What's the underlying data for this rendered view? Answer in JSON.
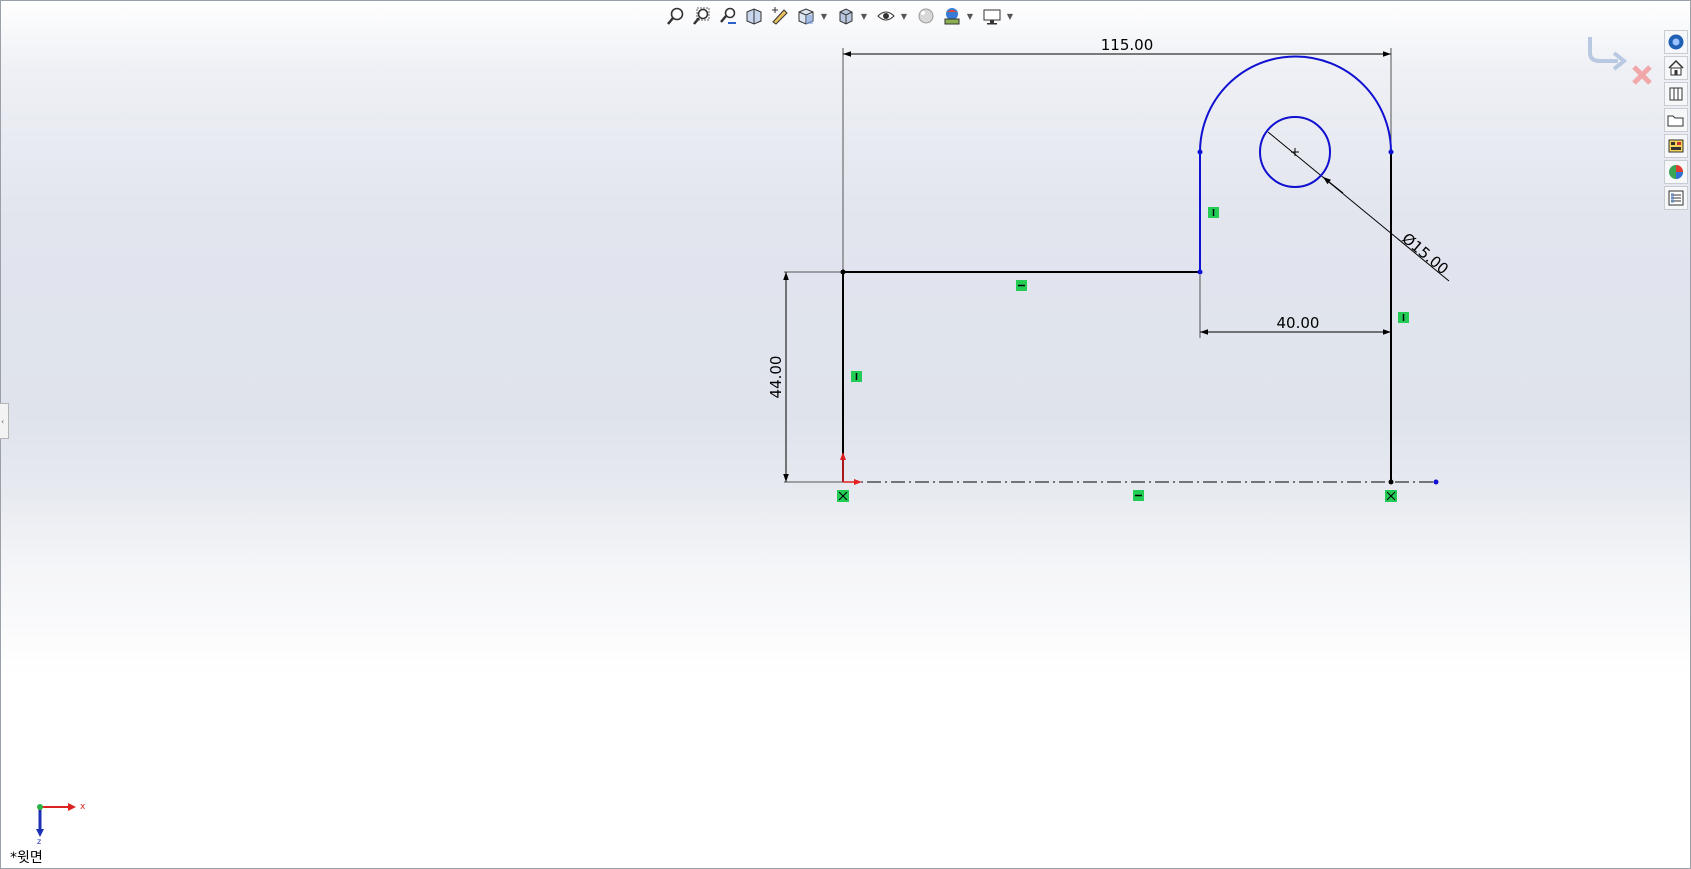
{
  "view": {
    "label": "*윗면"
  },
  "dimensions": {
    "overall_width": "115.00",
    "height": "44.00",
    "tab_width": "40.00",
    "hole_diameter": "Ø15.00"
  },
  "triad": {
    "x_label": "x",
    "z_label": "z"
  },
  "colors": {
    "sketch_defined": "#000000",
    "sketch_underdefined": "#1010d0",
    "relation_marker": "#22cc55",
    "origin_red": "#e02020"
  },
  "toolbar": {
    "icons": [
      "zoom-to-fit-icon",
      "zoom-to-area-icon",
      "previous-view-icon",
      "section-view-icon",
      "view-orientation-icon",
      "display-style-icon",
      "hide-show-items-icon",
      "edit-appearance-icon",
      "apply-scene-icon",
      "view-settings-icon"
    ]
  },
  "task_pane": {
    "icons": [
      "solidworks-resources-icon",
      "design-library-icon",
      "file-explorer-icon",
      "view-palette-icon",
      "appearances-icon",
      "custom-properties-icon"
    ]
  }
}
